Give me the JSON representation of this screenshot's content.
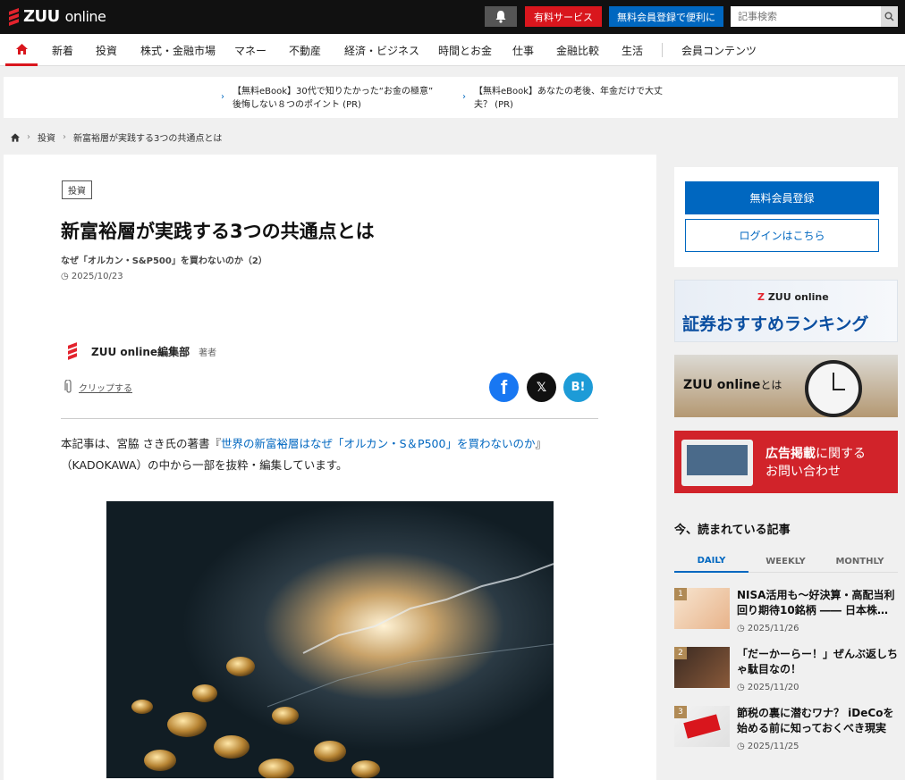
{
  "header": {
    "logo_main": "ZUU",
    "logo_sub": "online",
    "paid_service": "有料サービス",
    "free_register": "無料会員登録で便利に",
    "search_placeholder": "記事検索"
  },
  "nav": {
    "items": [
      "新着",
      "投資",
      "株式・金融市場",
      "マネー",
      "不動産",
      "経済・ビジネス",
      "時間とお金",
      "仕事",
      "金融比較",
      "生活",
      "会員コンテンツ"
    ]
  },
  "promo": {
    "items": [
      {
        "line1": "【無料eBook】30代で知りたかった“お金の極意”",
        "line2": "後悔しない８つのポイント (PR)"
      },
      {
        "line1": "【無料eBook】あなたの老後、年金だけで大丈",
        "line2": "夫？ (PR)"
      }
    ]
  },
  "breadcrumb": {
    "items": [
      "投資",
      "新富裕層が実践する3つの共通点とは"
    ]
  },
  "article": {
    "category": "投資",
    "title": "新富裕層が実践する3つの共通点とは",
    "subtitle": "なぜ「オルカン・S&P500」を買わないのか（2）",
    "date": "2025/10/23",
    "author": "ZUU online編集部",
    "author_role": "著者",
    "clip": "クリップする",
    "lead_before": "本記事は、宮脇 さき氏の著書『",
    "lead_link": "世界の新富裕層はなぜ「オルカン・S＆P500」を買わないのか",
    "lead_after": "』（KADOKAWA）の中から一部を抜粋・編集しています。"
  },
  "share": {
    "x_label": "𝕏",
    "hatena_label": "B!"
  },
  "sidebar": {
    "register": "無料会員登録",
    "login": "ログインはこちら",
    "banner1_logo": "ZUU online",
    "banner1_text": "証券おすすめランキング",
    "banner2_text_a": "ZUU online",
    "banner2_text_b": "とは",
    "banner3_line1_a": "広告掲載",
    "banner3_line1_b": "に関する",
    "banner3_line2": "お問い合わせ",
    "ranking_title": "今、読まれている記事",
    "tabs": [
      "DAILY",
      "WEEKLY",
      "MONTHLY"
    ],
    "ranking": [
      {
        "num": "1",
        "title": "NISA活用も〜好決算・高配当利回り期待10銘柄 ―― 日本株…",
        "date": "2025/11/26"
      },
      {
        "num": "2",
        "title": "「だーかーらー！」ぜんぶ返しちゃ駄目なの！",
        "date": "2025/11/20"
      },
      {
        "num": "3",
        "title": "節税の裏に潜むワナ？ iDeCoを始める前に知っておくべき現実",
        "date": "2025/11/25"
      }
    ]
  },
  "colors": {
    "brand_red": "#d9161d",
    "brand_blue": "#0067c0",
    "logo_red": "#e3232d"
  }
}
